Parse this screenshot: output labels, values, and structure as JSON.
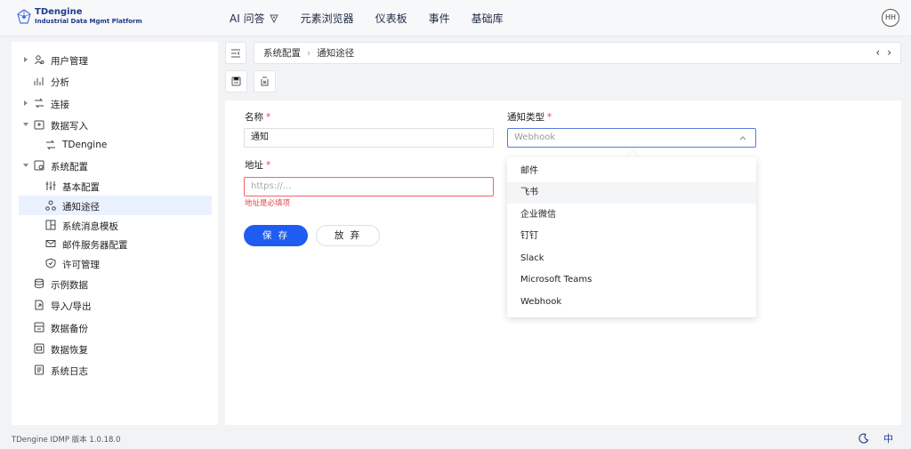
{
  "header": {
    "logo_title": "TDengine",
    "logo_subtitle": "Industrial Data Mgmt Platform",
    "nav": [
      "AI 问答",
      "元素浏览器",
      "仪表板",
      "事件",
      "基础库"
    ],
    "avatar": "HH"
  },
  "sidebar": {
    "items": [
      {
        "label": "用户管理",
        "icon": "users-icon",
        "expandable": true,
        "expanded": false
      },
      {
        "label": "分析",
        "icon": "analysis-icon"
      },
      {
        "label": "连接",
        "icon": "connection-icon",
        "expandable": true,
        "expanded": false
      },
      {
        "label": "数据写入",
        "icon": "data-write-icon",
        "expandable": true,
        "expanded": true
      },
      {
        "label": "TDengine",
        "icon": "connection-icon",
        "child": true
      },
      {
        "label": "系统配置",
        "icon": "system-config-icon",
        "expandable": true,
        "expanded": true
      },
      {
        "label": "基本配置",
        "icon": "sliders-icon",
        "child": true
      },
      {
        "label": "通知途径",
        "icon": "notification-route-icon",
        "child": true,
        "active": true
      },
      {
        "label": "系统消息模板",
        "icon": "template-icon",
        "child": true
      },
      {
        "label": "邮件服务器配置",
        "icon": "mail-icon",
        "child": true
      },
      {
        "label": "许可管理",
        "icon": "license-icon",
        "child": true
      },
      {
        "label": "示例数据",
        "icon": "database-icon"
      },
      {
        "label": "导入/导出",
        "icon": "import-export-icon"
      },
      {
        "label": "数据备份",
        "icon": "backup-icon"
      },
      {
        "label": "数据恢复",
        "icon": "restore-icon"
      },
      {
        "label": "系统日志",
        "icon": "log-icon"
      }
    ]
  },
  "breadcrumb": {
    "parent": "系统配置",
    "current": "通知途径"
  },
  "form": {
    "name_label": "名称",
    "name_value": "通知",
    "type_label": "通知类型",
    "type_placeholder": "Webhook",
    "address_label": "地址",
    "address_placeholder": "https://...",
    "address_error": "地址是必填项",
    "save_label": "保 存",
    "cancel_label": "放 弃"
  },
  "dropdown": {
    "options": [
      "邮件",
      "飞书",
      "企业微信",
      "钉钉",
      "Slack",
      "Microsoft Teams",
      "Webhook"
    ],
    "hovered": "飞书"
  },
  "footer": {
    "version": "TDengine IDMP 版本 1.0.18.0",
    "lang": "中"
  },
  "colors": {
    "primary": "#1f5cf2",
    "error": "#e5484d",
    "active_bg": "#eaf1ff"
  }
}
